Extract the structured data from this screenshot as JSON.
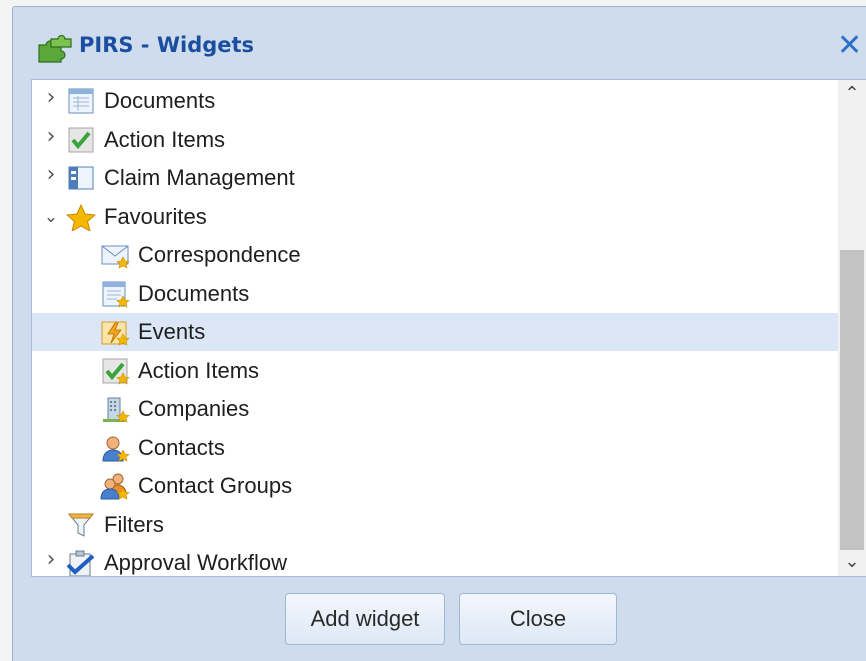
{
  "dialog": {
    "title": "PIRS - Widgets",
    "title_icon": "puzzle-plugin-icon",
    "close_glyph": "✕"
  },
  "tree": {
    "items": [
      {
        "name": "tree-item-documents",
        "label": "Documents",
        "toggle": "›",
        "icon": "document-table-icon",
        "level": 0
      },
      {
        "name": "tree-item-action-items",
        "label": "Action Items",
        "toggle": "›",
        "icon": "checkmark-icon",
        "level": 0
      },
      {
        "name": "tree-item-claim-management",
        "label": "Claim Management",
        "toggle": "›",
        "icon": "claim-panel-icon",
        "level": 0
      },
      {
        "name": "tree-item-favourites",
        "label": "Favourites",
        "toggle": "⌄",
        "icon": "star-icon",
        "level": 0
      },
      {
        "name": "tree-item-fav-correspondence",
        "label": "Correspondence",
        "icon": "envelope-star-icon",
        "level": 1
      },
      {
        "name": "tree-item-fav-documents",
        "label": "Documents",
        "icon": "document-star-icon",
        "level": 1
      },
      {
        "name": "tree-item-fav-events",
        "label": "Events",
        "icon": "lightning-star-icon",
        "level": 1,
        "selected": true
      },
      {
        "name": "tree-item-fav-action-items",
        "label": "Action Items",
        "icon": "checkmark-star-icon",
        "level": 1
      },
      {
        "name": "tree-item-fav-companies",
        "label": "Companies",
        "icon": "building-star-icon",
        "level": 1
      },
      {
        "name": "tree-item-fav-contacts",
        "label": "Contacts",
        "icon": "person-star-icon",
        "level": 1
      },
      {
        "name": "tree-item-fav-contact-groups",
        "label": "Contact Groups",
        "icon": "people-star-icon",
        "level": 1
      },
      {
        "name": "tree-item-filters",
        "label": "Filters",
        "icon": "funnel-icon",
        "level": 0
      },
      {
        "name": "tree-item-approval-workflow",
        "label": "Approval Workflow",
        "toggle": "›",
        "icon": "approval-clipboard-icon",
        "level": 0
      }
    ]
  },
  "scrollbar": {
    "up_glyph": "⌃",
    "down_glyph": "⌄"
  },
  "buttons": {
    "add_widget": "Add widget",
    "close": "Close"
  },
  "colors": {
    "dialog_bg": "#cfdced",
    "title_text": "#1c4ea0",
    "selected_row": "#dbe7f7"
  }
}
